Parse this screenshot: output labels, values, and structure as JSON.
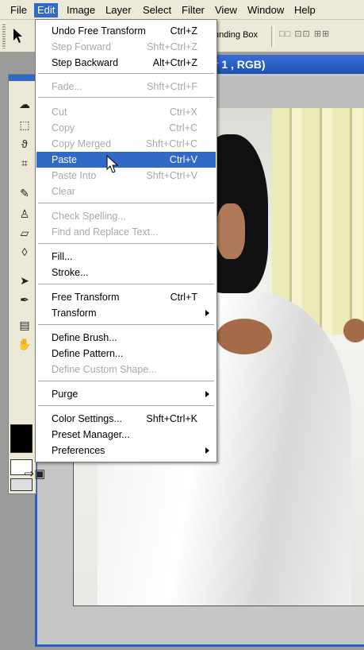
{
  "menubar": {
    "items": [
      "File",
      "Edit",
      "Image",
      "Layer",
      "Select",
      "Filter",
      "View",
      "Window",
      "Help"
    ],
    "active": "Edit"
  },
  "options_bar": {
    "bounding_box_label": "unding Box",
    "align_icons": "□□ ⊡⊡ ⊞⊞",
    "align_icon_name": "align-icons"
  },
  "document": {
    "title_fragment": "r 1 , RGB)"
  },
  "edit_menu": {
    "items": [
      {
        "label": "Undo Free Transform",
        "shortcut": "Ctrl+Z",
        "enabled": true
      },
      {
        "label": "Step Forward",
        "shortcut": "Shft+Ctrl+Z",
        "enabled": false
      },
      {
        "label": "Step Backward",
        "shortcut": "Alt+Ctrl+Z",
        "enabled": true
      },
      {
        "label": "Fade...",
        "shortcut": "Shft+Ctrl+F",
        "enabled": false
      },
      {
        "label": "Cut",
        "shortcut": "Ctrl+X",
        "enabled": false
      },
      {
        "label": "Copy",
        "shortcut": "Ctrl+C",
        "enabled": false
      },
      {
        "label": "Copy Merged",
        "shortcut": "Shft+Ctrl+C",
        "enabled": false
      },
      {
        "label": "Paste",
        "shortcut": "Ctrl+V",
        "enabled": true,
        "highlighted": true
      },
      {
        "label": "Paste Into",
        "shortcut": "Shft+Ctrl+V",
        "enabled": false
      },
      {
        "label": "Clear",
        "shortcut": "",
        "enabled": false
      },
      {
        "label": "Check Spelling...",
        "shortcut": "",
        "enabled": false
      },
      {
        "label": "Find and Replace Text...",
        "shortcut": "",
        "enabled": false
      },
      {
        "label": "Fill...",
        "shortcut": "",
        "enabled": true
      },
      {
        "label": "Stroke...",
        "shortcut": "",
        "enabled": true
      },
      {
        "label": "Free Transform",
        "shortcut": "Ctrl+T",
        "enabled": true
      },
      {
        "label": "Transform",
        "shortcut": "",
        "enabled": true,
        "submenu": true
      },
      {
        "label": "Define Brush...",
        "shortcut": "",
        "enabled": true
      },
      {
        "label": "Define Pattern...",
        "shortcut": "",
        "enabled": true
      },
      {
        "label": "Define Custom Shape...",
        "shortcut": "",
        "enabled": false
      },
      {
        "label": "Purge",
        "shortcut": "",
        "enabled": true,
        "submenu": true
      },
      {
        "label": "Color Settings...",
        "shortcut": "Shft+Ctrl+K",
        "enabled": true
      },
      {
        "label": "Preset Manager...",
        "shortcut": "",
        "enabled": true
      },
      {
        "label": "Preferences",
        "shortcut": "",
        "enabled": true,
        "submenu": true
      }
    ]
  },
  "colors": {
    "highlight": "#3169c6",
    "title_bar": "#1c4fb0",
    "menu_bg": "#ece9d8",
    "disabled_text": "#a9a8a1"
  }
}
